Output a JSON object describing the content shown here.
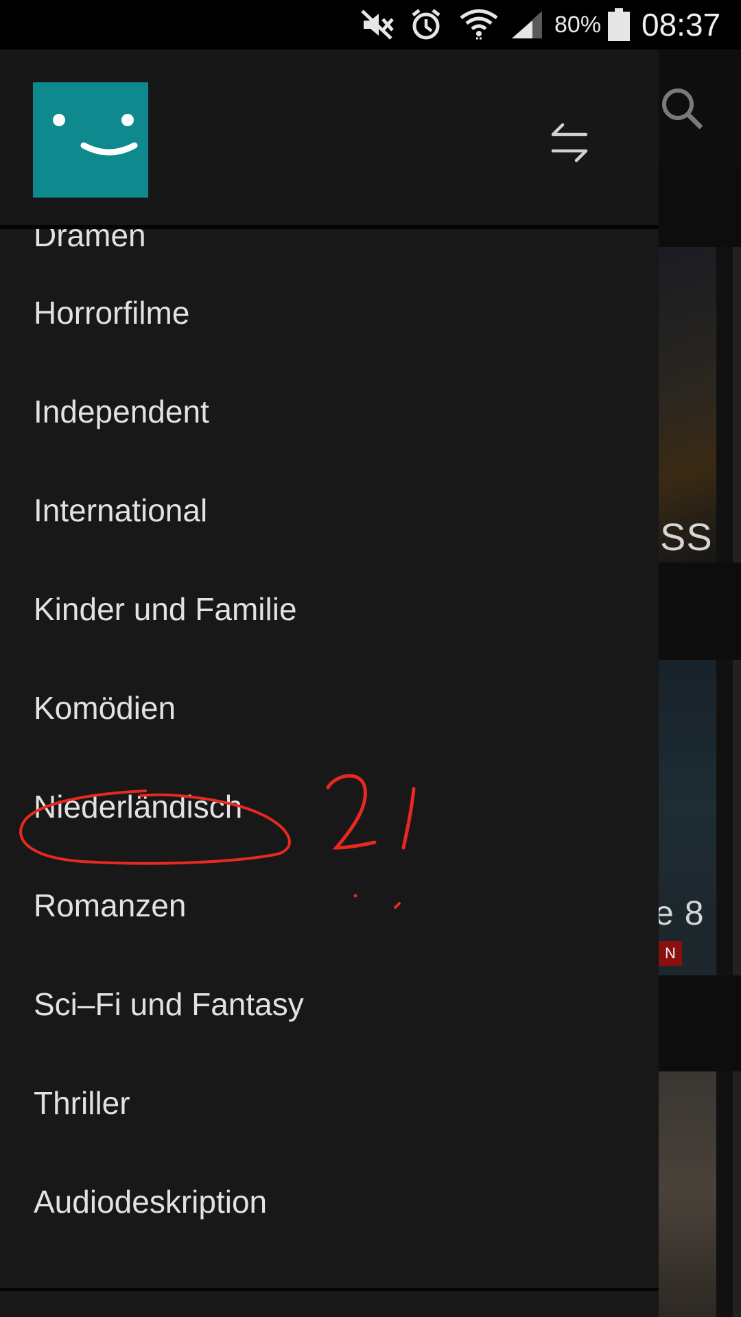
{
  "status_bar": {
    "battery_percent": "80%",
    "time": "08:37",
    "icons": [
      "mute-icon",
      "alarm-icon",
      "wifi-icon",
      "signal-icon",
      "battery-icon"
    ]
  },
  "drawer": {
    "avatar_color": "#0e8a8f",
    "avatar_icon": "smiley-face-icon",
    "switch_icon": "switch-profile-arrows-icon",
    "items": [
      {
        "label": "Dramen"
      },
      {
        "label": "Horrorfilme"
      },
      {
        "label": "Independent"
      },
      {
        "label": "International"
      },
      {
        "label": "Kinder und Familie"
      },
      {
        "label": "Komödien"
      },
      {
        "label": "Niederländisch"
      },
      {
        "label": "Romanzen"
      },
      {
        "label": "Sci–Fi und Fantasy"
      },
      {
        "label": "Thriller"
      },
      {
        "label": "Audiodeskription"
      }
    ]
  },
  "background": {
    "search_icon": "search-icon",
    "poster_text_1": "SS",
    "poster_text_2": "e 8",
    "poster_badge": "N"
  },
  "annotation": {
    "text": "2!",
    "color": "#e8291f",
    "circled_item": "Niederländisch"
  }
}
